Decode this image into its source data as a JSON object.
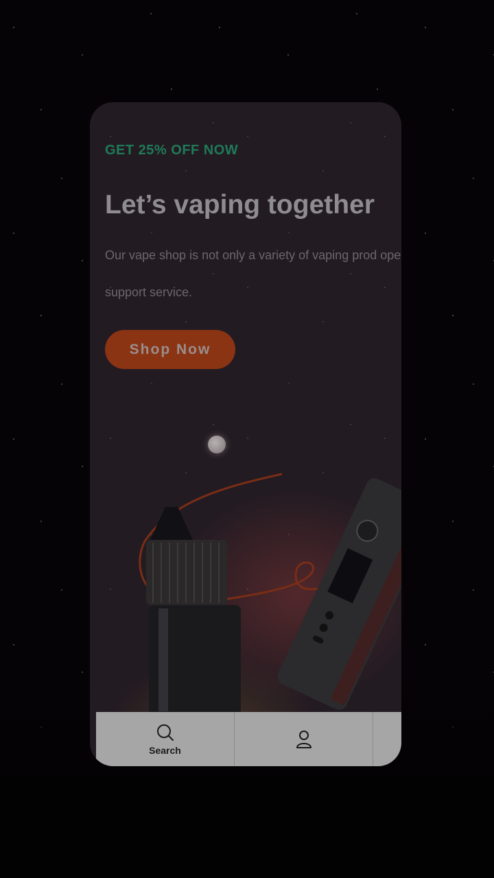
{
  "hero": {
    "promo": "GET 25% OFF NOW",
    "headline": "Let’s vaping together",
    "description": "Our vape shop is not only a variety of vaping prod operational support service.",
    "cta_label": "Shop Now"
  },
  "bottom_nav": {
    "items": [
      {
        "label": "Search",
        "icon": "search-icon"
      },
      {
        "label": "",
        "icon": "user-icon"
      },
      {
        "label": "",
        "icon": ""
      }
    ]
  },
  "colors": {
    "accent_green": "#1f7a57",
    "cta_orange": "#8a3414",
    "background": "#050305"
  }
}
